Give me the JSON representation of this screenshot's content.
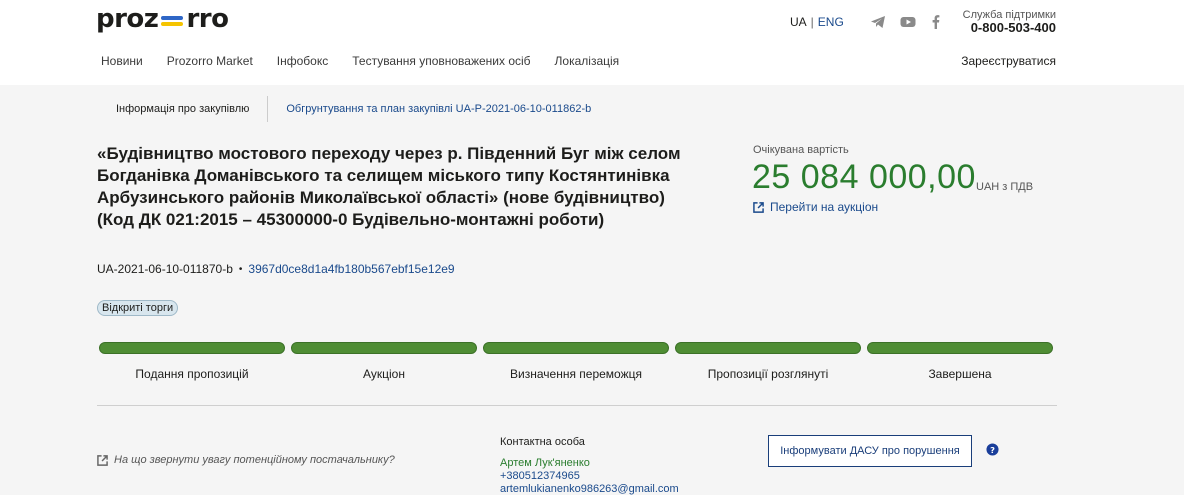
{
  "header": {
    "logo_left": "proz",
    "logo_right": "rro",
    "lang_ua": "UA",
    "lang_sep": "|",
    "lang_eng": "ENG",
    "support_label": "Служба підтримки",
    "support_phone": "0-800-503-400",
    "register": "Зареєструватися",
    "nav": [
      "Новини",
      "Prozorro Market",
      "Інфобокс",
      "Тестування уповноважених осіб",
      "Локалізація"
    ]
  },
  "subnav": {
    "active": "Інформація про закупівлю",
    "link": "Обгрунтування та план закупівлі UA-P-2021-06-10-011862-b"
  },
  "tender": {
    "title": "«Будівництво мостового переходу через р. Південний Буг між селом Богданівка Доманівського та селищем міського типу Костянтинівка Арбузинського районів Миколаївської області» (нове будівництво) (Код ДК 021:2015 – 45300000-0 Будівельно-монтажні роботи)",
    "id": "UA-2021-06-10-011870-b",
    "bullet": "•",
    "hash": "3967d0ce8d1a4fb180b567ebf15e12e9",
    "badge": "Відкриті торги"
  },
  "value": {
    "label": "Очікувана вартість",
    "amount": "25 084 000,00",
    "currency": "UAH з ПДВ",
    "auction_link": "Перейти на аукціон"
  },
  "stages": [
    {
      "label": "Подання пропозицій",
      "progress": 1
    },
    {
      "label": "Аукціон",
      "progress": 1
    },
    {
      "label": "Визначення переможця",
      "progress": 1
    },
    {
      "label": "Пропозиції розглянуті",
      "progress": 1
    },
    {
      "label": "Завершена",
      "progress": 1
    }
  ],
  "footer": {
    "attention": "На що звернути увагу потенційному постачальнику?",
    "contact_heading": "Контактна особа",
    "contact_name": "Артем Лук'яненко",
    "contact_phone": "+380512374965",
    "contact_email": "artemlukianenko986263@gmail.com",
    "dasu_button": "Інформувати ДАСУ про порушення"
  },
  "colors": {
    "accent_green": "#2a7d2e",
    "stage_green": "#4f8d34",
    "link_blue": "#1a4a8c",
    "flag_blue": "#2e66c6",
    "flag_yellow": "#f5c400"
  }
}
